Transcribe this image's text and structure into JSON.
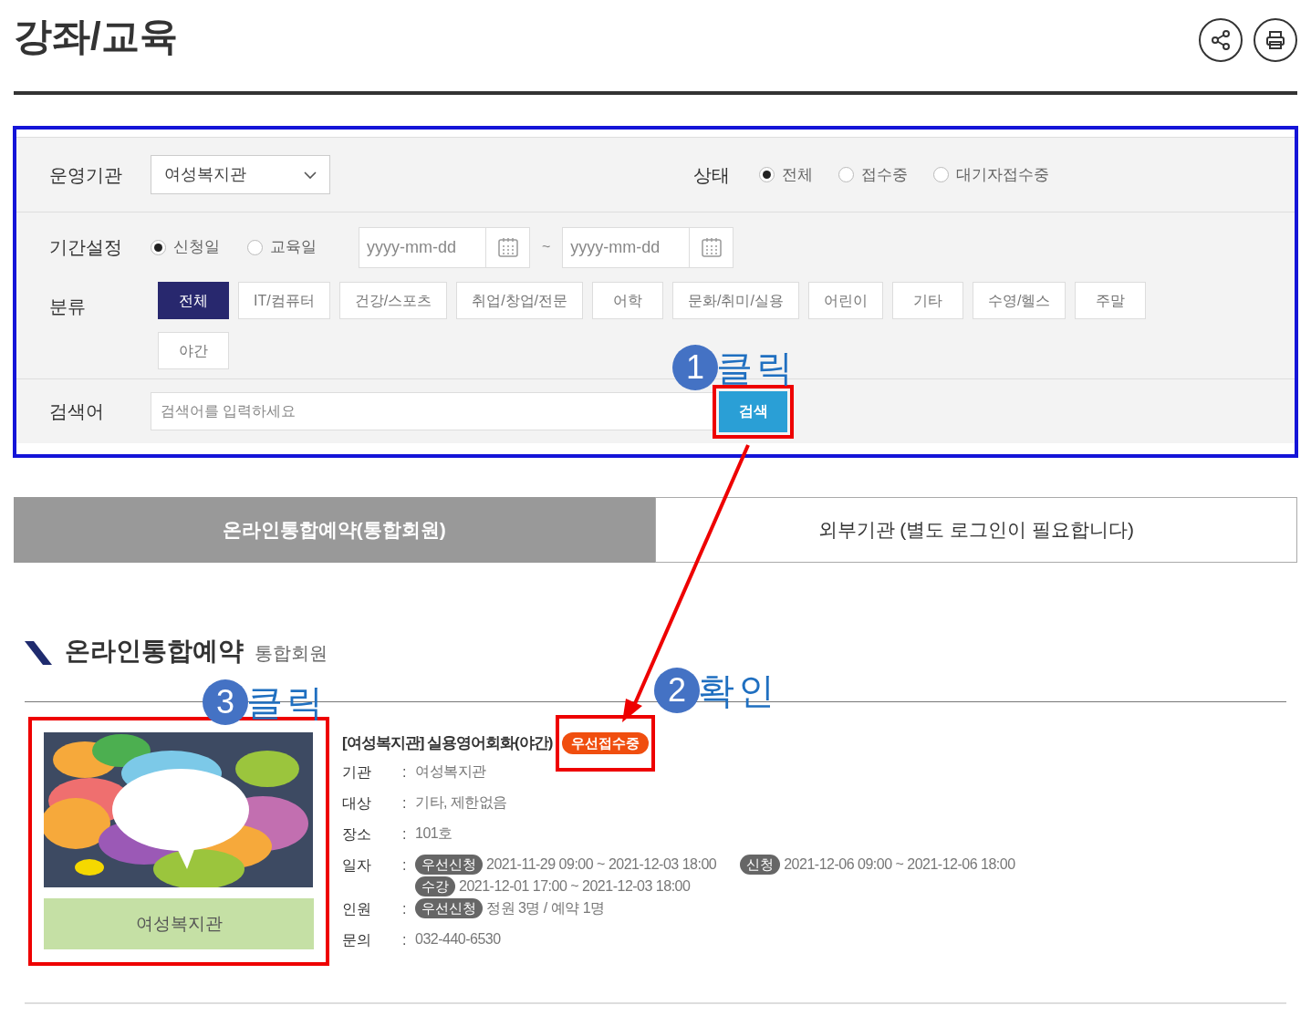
{
  "page": {
    "title": "강좌/교육"
  },
  "filters": {
    "organization": {
      "label": "운영기관",
      "value": "여성복지관"
    },
    "status": {
      "label": "상태",
      "options": [
        {
          "label": "전체",
          "selected": true
        },
        {
          "label": "접수중",
          "selected": false
        },
        {
          "label": "대기자접수중",
          "selected": false
        }
      ]
    },
    "period": {
      "label": "기간설정",
      "options": [
        {
          "label": "신청일",
          "selected": true
        },
        {
          "label": "교육일",
          "selected": false
        }
      ],
      "start": {
        "placeholder": "yyyy-mm-dd"
      },
      "separator": "~",
      "end": {
        "placeholder": "yyyy-mm-dd"
      }
    },
    "category": {
      "label": "분류",
      "options": [
        {
          "label": "전체",
          "selected": true
        },
        {
          "label": "IT/컴퓨터",
          "selected": false
        },
        {
          "label": "건강/스포츠",
          "selected": false
        },
        {
          "label": "취업/창업/전문",
          "selected": false
        },
        {
          "label": "어학",
          "selected": false
        },
        {
          "label": "문화/취미/실용",
          "selected": false
        },
        {
          "label": "어린이",
          "selected": false
        },
        {
          "label": "기타",
          "selected": false
        },
        {
          "label": "수영/헬스",
          "selected": false
        },
        {
          "label": "주말",
          "selected": false
        },
        {
          "label": "야간",
          "selected": false
        }
      ]
    },
    "keyword": {
      "label": "검색어",
      "placeholder": "검색어를 입력하세요",
      "button": "검색"
    }
  },
  "tabs": [
    {
      "label": "온라인통합예약(통합회원)",
      "selected": true
    },
    {
      "label": "외부기관 (별도 로그인이 필요합니다)",
      "selected": false
    }
  ],
  "section": {
    "title": "온라인통합예약",
    "subtitle": "통합회원"
  },
  "course": {
    "organization_label": "여성복지관",
    "title": "[여성복지관] 실용영어회화(야간)",
    "badge": "우선접수중",
    "details": [
      {
        "label": "기관",
        "colon": ":",
        "lines": [
          [
            {
              "text": "여성복지관"
            }
          ]
        ]
      },
      {
        "label": "대상",
        "colon": ":",
        "lines": [
          [
            {
              "text": "기타, 제한없음"
            }
          ]
        ]
      },
      {
        "label": "장소",
        "colon": ":",
        "lines": [
          [
            {
              "text": "101호"
            }
          ]
        ]
      },
      {
        "label": "일자",
        "colon": ":",
        "lines": [
          [
            {
              "tag": "우선신청",
              "text": "2021-11-29 09:00 ~ 2021-12-03 18:00"
            },
            {
              "tag": "신청",
              "text": "2021-12-06 09:00 ~ 2021-12-06 18:00"
            }
          ],
          [
            {
              "tag": "수강",
              "text": "2021-12-01 17:00 ~ 2021-12-03 18:00"
            }
          ]
        ]
      },
      {
        "label": "인원",
        "colon": ":",
        "lines": [
          [
            {
              "tag": "우선신청",
              "text": "정원 3명 / 예약 1명"
            }
          ]
        ]
      },
      {
        "label": "문의",
        "colon": ":",
        "lines": [
          [
            {
              "text": "032-440-6530"
            }
          ]
        ]
      }
    ]
  },
  "annotations": [
    {
      "number": "1",
      "text": "클릭"
    },
    {
      "number": "2",
      "text": "확인"
    },
    {
      "number": "3",
      "text": "클릭"
    }
  ]
}
